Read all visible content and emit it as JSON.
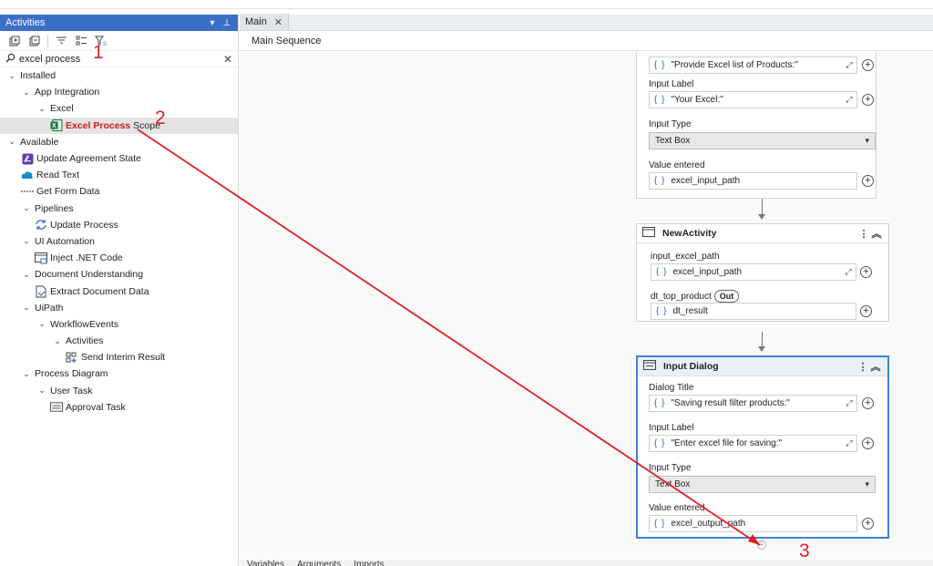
{
  "left_panel": {
    "title": "Activities",
    "search_value": "excel process",
    "tree": [
      {
        "label": "Installed"
      },
      {
        "label": "App Integration"
      },
      {
        "label": "Excel"
      },
      {
        "label_highlight": "Excel Process",
        "label_rest": " Scope"
      },
      {
        "label": "Available"
      },
      {
        "label": "Update Agreement State"
      },
      {
        "label": "Read Text"
      },
      {
        "label": "Get Form Data"
      },
      {
        "label": "Pipelines"
      },
      {
        "label": "Update Process"
      },
      {
        "label": "UI Automation"
      },
      {
        "label": "Inject .NET Code"
      },
      {
        "label": "Document Understanding"
      },
      {
        "label": "Extract Document Data"
      },
      {
        "label": "UiPath"
      },
      {
        "label": "WorkflowEvents"
      },
      {
        "label": "Activities"
      },
      {
        "label": "Send Interim Result"
      },
      {
        "label": "Process Diagram"
      },
      {
        "label": "User Task"
      },
      {
        "label": "Approval Task"
      }
    ]
  },
  "designer": {
    "tab_label": "Main",
    "breadcrumb": "Main Sequence",
    "card1": {
      "dialog_title_value": "\"Provide Excel list of Products:\"",
      "input_label_label": "Input Label",
      "input_label_value": "\"Your Excel:\"",
      "input_type_label": "Input Type",
      "input_type_value": "Text Box",
      "value_entered_label": "Value entered",
      "value_entered_value": "excel_input_path"
    },
    "card2": {
      "title": "NewActivity",
      "arg1_label": "input_excel_path",
      "arg1_value": "excel_input_path",
      "arg2_label": "dt_top_product",
      "arg2_badge": "Out",
      "arg2_value": "dt_result"
    },
    "card3": {
      "title": "Input Dialog",
      "dialog_title_label": "Dialog Title",
      "dialog_title_value": "\"Saving result filter products:\"",
      "input_label_label": "Input Label",
      "input_label_value": "\"Enter excel file for saving:\"",
      "input_type_label": "Input Type",
      "input_type_value": "Text Box",
      "value_entered_label": "Value entered",
      "value_entered_value": "excel_output_path"
    },
    "bottom_tabs": [
      "Variables",
      "Arguments",
      "Imports"
    ]
  },
  "annotations": {
    "step1": "1",
    "step2": "2",
    "step3": "3",
    "arrow_color": "#e02020"
  },
  "colors": {
    "panel_header": "#3b6fc7",
    "selected_card_border": "#3d82d6",
    "search_highlight": "#d21b1b"
  }
}
